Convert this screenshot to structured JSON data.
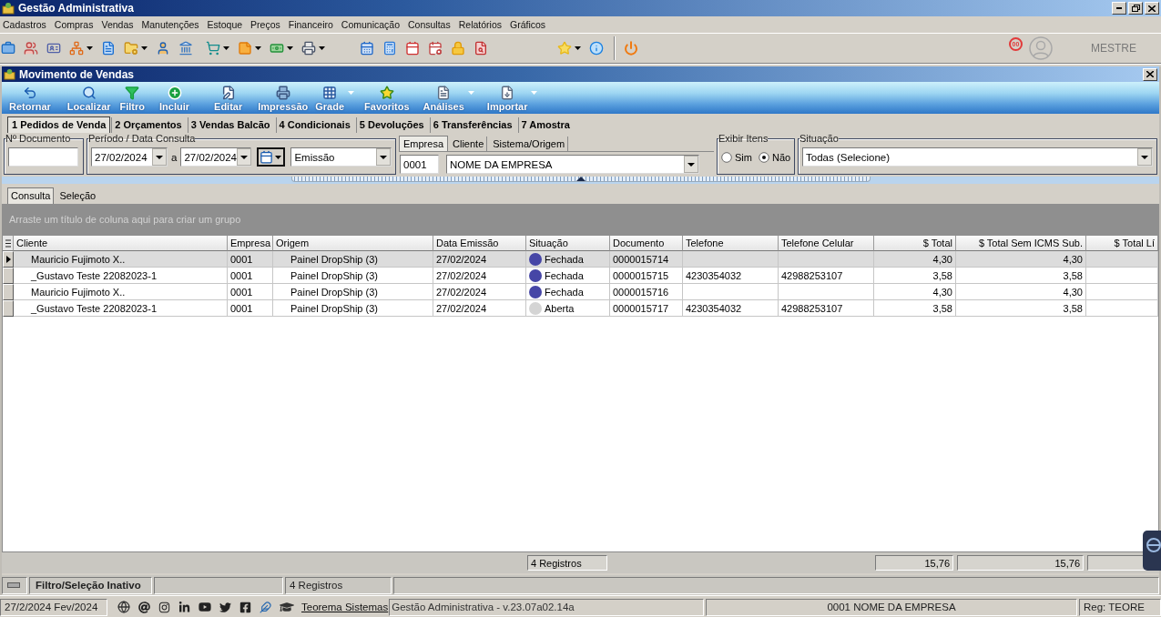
{
  "window": {
    "title": "Gestão Administrativa"
  },
  "menu": [
    "Cadastros",
    "Compras",
    "Vendas",
    "Manutenções",
    "Estoque",
    "Preços",
    "Financeiro",
    "Comunicação",
    "Consultas",
    "Relatórios",
    "Gráficos"
  ],
  "user": {
    "badge": "00",
    "name": "MESTRE"
  },
  "form": {
    "title": "Movimento de Vendas"
  },
  "actions": [
    {
      "label": "Retornar",
      "dropdown": false
    },
    {
      "label": "Localizar",
      "dropdown": false
    },
    {
      "label": "Filtro",
      "dropdown": false
    },
    {
      "label": "Incluir",
      "dropdown": false
    },
    {
      "label": "Editar",
      "dropdown": false
    },
    {
      "label": "Impressão",
      "dropdown": false
    },
    {
      "label": "Grade",
      "dropdown": true
    },
    {
      "label": "Favoritos",
      "dropdown": false
    },
    {
      "label": "Análises",
      "dropdown": true
    },
    {
      "label": "Importar",
      "dropdown": true
    }
  ],
  "tabs": [
    {
      "label": "1 Pedidos de Venda",
      "selected": true
    },
    {
      "label": "2 Orçamentos",
      "selected": false
    },
    {
      "label": "3 Vendas Balcão",
      "selected": false
    },
    {
      "label": "4 Condicionais",
      "selected": false
    },
    {
      "label": "5 Devoluções",
      "selected": false
    },
    {
      "label": "6 Transferências",
      "selected": false
    },
    {
      "label": "7 Amostra",
      "selected": false
    }
  ],
  "filters": {
    "document": {
      "label": "Nº Documento"
    },
    "period": {
      "label": "Período / Data Consulta",
      "from": "27/02/2024",
      "separator": "a",
      "to": "27/02/2024",
      "date_type": "Emissão"
    },
    "scope_tabs": [
      {
        "label": "Empresa",
        "selected": true
      },
      {
        "label": "Cliente",
        "selected": false
      },
      {
        "label": "Sistema/Origem",
        "selected": false
      }
    ],
    "company": {
      "code": "0001",
      "name": "NOME DA EMPRESA"
    },
    "show_items": {
      "label": "Exibir Itens",
      "options": [
        {
          "label": "Sim",
          "selected": false
        },
        {
          "label": "Não",
          "selected": true
        }
      ]
    },
    "status": {
      "label": "Situação",
      "value": "Todas (Selecione)"
    }
  },
  "view_tabs": [
    {
      "label": "Consulta",
      "selected": true
    },
    {
      "label": "Seleção",
      "selected": false
    }
  ],
  "group_panel": {
    "hint": "Arraste um título de coluna aqui para criar um grupo"
  },
  "table": {
    "columns": [
      {
        "label": "Cliente",
        "kind": "indented"
      },
      {
        "label": "Empresa",
        "kind": "text"
      },
      {
        "label": "Origem",
        "kind": "indented"
      },
      {
        "label": "Data Emissão",
        "kind": "text"
      },
      {
        "label": "Situação",
        "kind": "status"
      },
      {
        "label": "Documento",
        "kind": "text"
      },
      {
        "label": "Telefone",
        "kind": "text"
      },
      {
        "label": "Telefone Celular",
        "kind": "text"
      },
      {
        "label": "$ Total",
        "kind": "money"
      },
      {
        "label": "$ Total Sem ICMS Sub.",
        "kind": "money"
      },
      {
        "label": "$ Total Lí",
        "kind": "money"
      }
    ],
    "rows": [
      {
        "selected": true,
        "client": "Mauricio Fujimoto X..",
        "company": "0001",
        "origin": "Painel DropShip (3)",
        "issue_date": "27/02/2024",
        "status": {
          "label": "Fechada",
          "color": "#4646a6"
        },
        "document": "0000015714",
        "total": "4,30",
        "total_no_icms": "4,30"
      },
      {
        "selected": false,
        "client": "_Gustavo Teste 22082023-1",
        "company": "0001",
        "origin": "Painel DropShip (3)",
        "issue_date": "27/02/2024",
        "status": {
          "label": "Fechada",
          "color": "#4646a6"
        },
        "document": "0000015715",
        "phone": "4230354032",
        "mobile": "42988253107",
        "total": "3,58",
        "total_no_icms": "3,58"
      },
      {
        "selected": false,
        "client": "Mauricio Fujimoto X..",
        "company": "0001",
        "origin": "Painel DropShip (3)",
        "issue_date": "27/02/2024",
        "status": {
          "label": "Fechada",
          "color": "#4646a6"
        },
        "document": "0000015716",
        "total": "4,30",
        "total_no_icms": "4,30"
      },
      {
        "selected": false,
        "client": "_Gustavo Teste 22082023-1",
        "company": "0001",
        "origin": "Painel DropShip (3)",
        "issue_date": "27/02/2024",
        "status": {
          "label": "Aberta",
          "color": "#d4d4d4"
        },
        "document": "0000015717",
        "phone": "4230354032",
        "mobile": "42988253107",
        "total": "3,58",
        "total_no_icms": "3,58"
      }
    ]
  },
  "footer": {
    "count": "4 Registros",
    "total": "15,76",
    "total_no_icms": "15,76"
  },
  "status_bar": {
    "filter": "Filtro/Seleção Inativo",
    "records": "4 Registros"
  },
  "bottom_bar": {
    "date": "27/2/2024 Fev/2024",
    "link": "Teorema Sistemas",
    "version": "Gestão Administrativa - v.23.07a02.14a",
    "company": "0001 NOME DA EMPRESA",
    "registration": "Reg: TEORE"
  }
}
